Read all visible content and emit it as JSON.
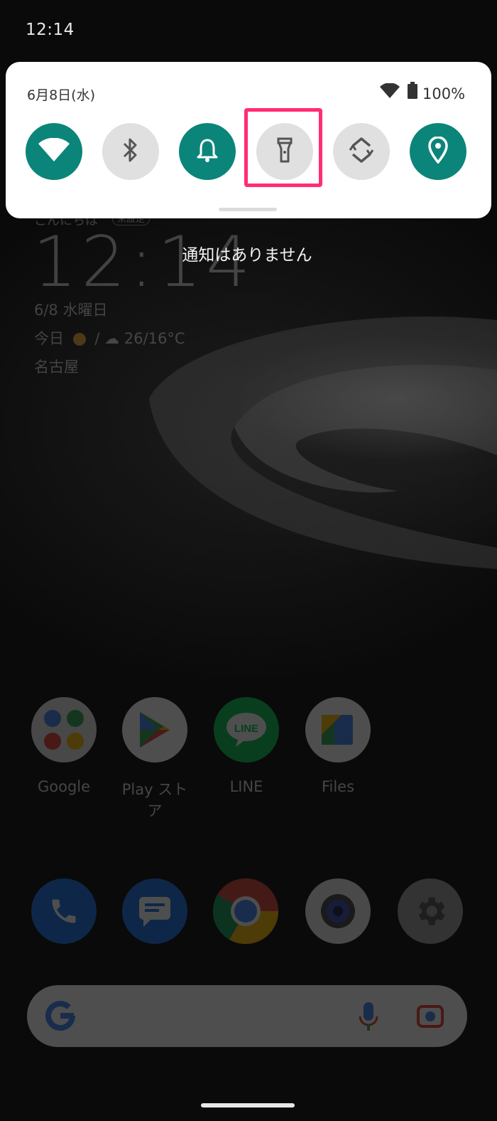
{
  "status_bar": {
    "time": "12:14"
  },
  "quick_settings": {
    "date": "6月8日(水)",
    "battery_percent": "100%",
    "tiles": [
      {
        "name": "wifi",
        "icon": "wifi-icon",
        "state": "on"
      },
      {
        "name": "bluetooth",
        "icon": "bluetooth-icon",
        "state": "off"
      },
      {
        "name": "sound",
        "icon": "bell-icon",
        "state": "on"
      },
      {
        "name": "flashlight",
        "icon": "flashlight-icon",
        "state": "off",
        "highlighted": true
      },
      {
        "name": "auto-rotate",
        "icon": "rotate-icon",
        "state": "off"
      },
      {
        "name": "location",
        "icon": "location-pin-icon",
        "state": "on"
      }
    ],
    "colors": {
      "tile_on": "#0b8579",
      "tile_off": "#e0e0e0",
      "highlight": "#ff2d73"
    }
  },
  "notifications": {
    "empty_text": "通知はありません"
  },
  "home_widget": {
    "greeting": "こんにちは",
    "greeting_badge": "未設定",
    "clock": "12:14",
    "date": "6/8 水曜日",
    "weather_label": "今日",
    "weather_separator": "/",
    "temperature": "26/16°C",
    "city": "名古屋"
  },
  "apps": [
    {
      "label": "Google",
      "icon": "google-folder-icon"
    },
    {
      "label": "Play ストア",
      "icon": "play-store-icon"
    },
    {
      "label": "LINE",
      "icon": "line-icon"
    },
    {
      "label": "Files",
      "icon": "files-icon"
    }
  ],
  "dock": [
    {
      "icon": "phone-icon"
    },
    {
      "icon": "messages-icon"
    },
    {
      "icon": "chrome-icon"
    },
    {
      "icon": "camera-icon"
    },
    {
      "icon": "settings-icon"
    }
  ],
  "search_bar": {
    "icons": [
      "google-g-icon",
      "microphone-icon",
      "lens-icon"
    ]
  }
}
